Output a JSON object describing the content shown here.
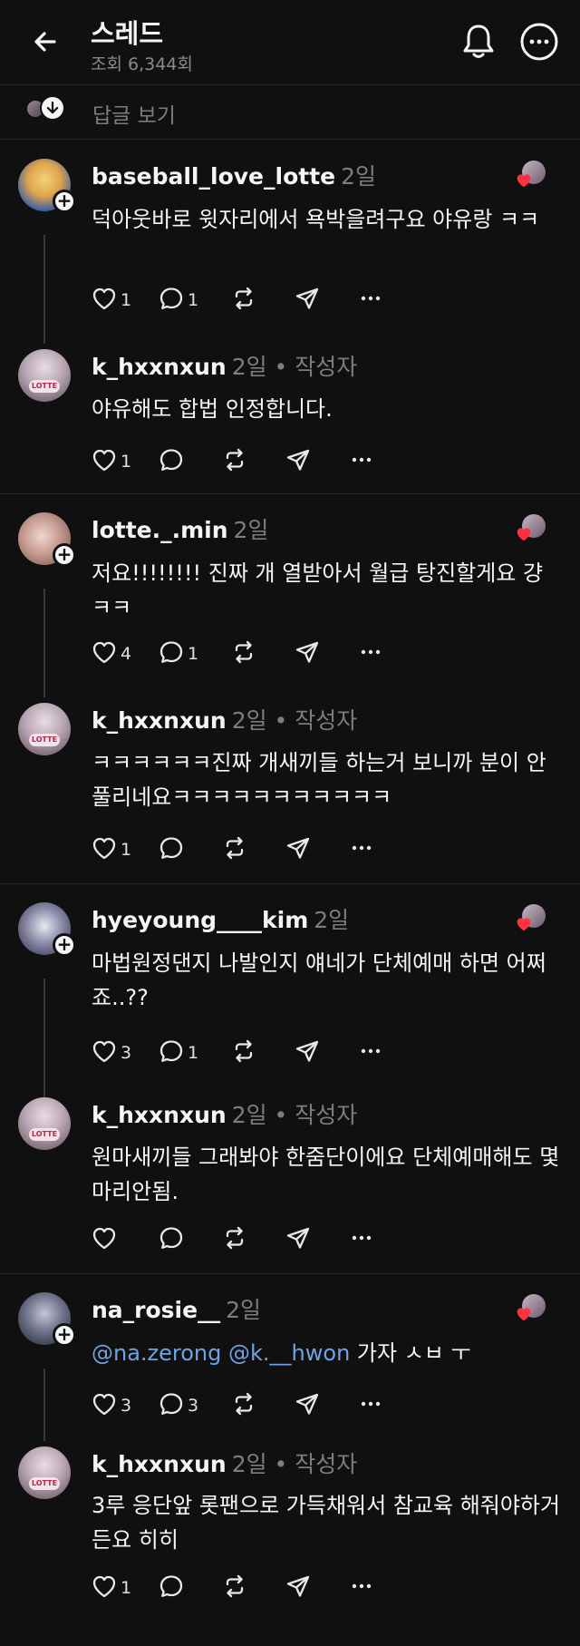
{
  "header": {
    "title": "스레드",
    "views": "조회 6,344회"
  },
  "view_replies": {
    "label": "답글 보기"
  },
  "threads": [
    {
      "comment": {
        "username": "baseball_love_lotte",
        "time": "2일",
        "text": "덕아웃바로 윗자리에서 욕박을려구요 야유랑 ㅋㅋ",
        "likes": "1",
        "replies": "1"
      },
      "reply": {
        "username": "k_hxxnxun",
        "time": "2일",
        "author_tag": " • 작성자",
        "text": "야유해도 합법 인정합니다.",
        "likes": "1",
        "replies": ""
      }
    },
    {
      "comment": {
        "username": "lotte._.min",
        "time": "2일",
        "text": "저요!!!!!!!! 진짜 개 열받아서 월급 탕진할게요 걍 ㅋㅋ",
        "likes": "4",
        "replies": "1"
      },
      "reply": {
        "username": "k_hxxnxun",
        "time": "2일",
        "author_tag": " • 작성자",
        "text": "ㅋㅋㅋㅋㅋㅋ진짜 개새끼들 하는거 보니까 분이 안풀리네요ㅋㅋㅋㅋㅋㅋㅋㅋㅋㅋㅋ",
        "likes": "1",
        "replies": ""
      }
    },
    {
      "comment": {
        "username": "hyeyoung____kim",
        "time": "2일",
        "text": "마법원정댄지 나발인지 얘네가 단체예매 하면 어쩌죠..??",
        "likes": "3",
        "replies": "1"
      },
      "reply": {
        "username": "k_hxxnxun",
        "time": "2일",
        "author_tag": " • 작성자",
        "text": "원마새끼들 그래봐야 한줌단이에요 단체예매해도 몇마리안됨.",
        "likes": "",
        "replies": ""
      }
    },
    {
      "comment": {
        "username": "na_rosie__",
        "time": "2일",
        "mention1": "@na.zerong",
        "mention2": "@k.__hwon",
        "text": " 가자 ㅅㅂ ㅜ",
        "likes": "3",
        "replies": "3"
      },
      "reply": {
        "username": "k_hxxnxun",
        "time": "2일",
        "author_tag": " • 작성자",
        "text": "3루 응단앞 롯팬으로 가득채워서 참교육 해줘야하거든요 히히",
        "likes": "1",
        "replies": ""
      }
    }
  ],
  "avatar_badge": "LOTTE",
  "colors": {
    "background": "#101010",
    "text": "#f3f5f7",
    "muted": "#7d7d7d",
    "mention": "#6fa3e3",
    "heart": "#ff3040"
  },
  "icons": [
    "back-arrow-icon",
    "bell-icon",
    "more-circle-icon",
    "heart-icon",
    "comment-icon",
    "repost-icon",
    "share-icon",
    "more-dots-icon",
    "plus-icon",
    "arrow-down-icon"
  ]
}
